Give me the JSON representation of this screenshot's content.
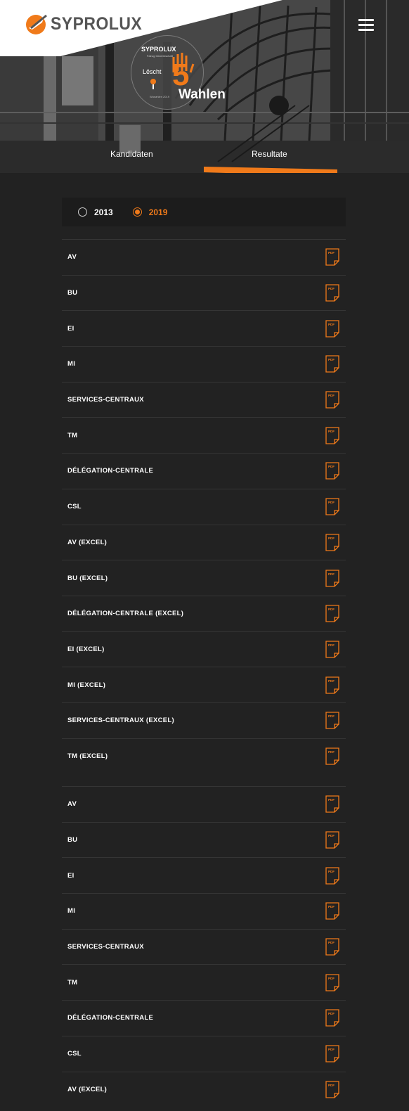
{
  "brand": {
    "name": "SYPROLUX",
    "accent": "#f07a1a"
  },
  "header": {
    "menu_icon": "hamburger-icon"
  },
  "badge": {
    "brand": "SYPROLUX",
    "subtitle": "Fairug Gewerkschaft",
    "loscht": "Lëscht",
    "number": "5",
    "footer": "Wunahlen 2019",
    "heading": "Wahlen"
  },
  "tabs": [
    {
      "label": "Kandidaten",
      "active": false
    },
    {
      "label": "Resultate",
      "active": true
    }
  ],
  "year_filter": {
    "options": [
      {
        "label": "2013",
        "checked": false
      },
      {
        "label": "2019",
        "checked": true
      }
    ]
  },
  "results_group_1": [
    {
      "label": "AV",
      "icon": "pdf-icon"
    },
    {
      "label": "BU",
      "icon": "pdf-icon"
    },
    {
      "label": "EI",
      "icon": "pdf-icon"
    },
    {
      "label": "MI",
      "icon": "pdf-icon"
    },
    {
      "label": "SERVICES-CENTRAUX",
      "icon": "pdf-icon"
    },
    {
      "label": "TM",
      "icon": "pdf-icon"
    },
    {
      "label": "DÉLÉGATION-CENTRALE",
      "icon": "pdf-icon"
    },
    {
      "label": "CSL",
      "icon": "pdf-icon"
    },
    {
      "label": "AV (EXCEL)",
      "icon": "pdf-icon"
    },
    {
      "label": "BU (EXCEL)",
      "icon": "pdf-icon"
    },
    {
      "label": "DÉLÉGATION-CENTRALE (EXCEL)",
      "icon": "pdf-icon"
    },
    {
      "label": "EI (EXCEL)",
      "icon": "pdf-icon"
    },
    {
      "label": "MI (EXCEL)",
      "icon": "pdf-icon"
    },
    {
      "label": "SERVICES-CENTRAUX (EXCEL)",
      "icon": "pdf-icon"
    },
    {
      "label": "TM (EXCEL)",
      "icon": "pdf-icon"
    }
  ],
  "results_group_2": [
    {
      "label": "AV",
      "icon": "pdf-icon"
    },
    {
      "label": "BU",
      "icon": "pdf-icon"
    },
    {
      "label": "EI",
      "icon": "pdf-icon"
    },
    {
      "label": "MI",
      "icon": "pdf-icon"
    },
    {
      "label": "SERVICES-CENTRAUX",
      "icon": "pdf-icon"
    },
    {
      "label": "TM",
      "icon": "pdf-icon"
    },
    {
      "label": "DÉLÉGATION-CENTRALE",
      "icon": "pdf-icon"
    },
    {
      "label": "CSL",
      "icon": "pdf-icon"
    },
    {
      "label": "AV (EXCEL)",
      "icon": "pdf-icon"
    }
  ],
  "pdf_icon_text": "PDF"
}
